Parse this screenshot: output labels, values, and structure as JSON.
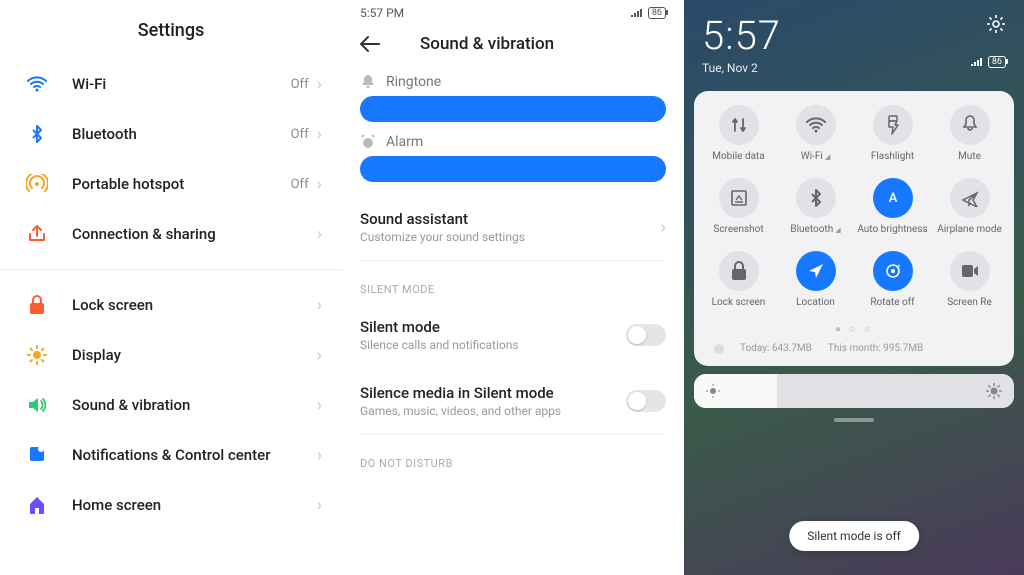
{
  "panel1": {
    "title": "Settings",
    "groups": [
      [
        {
          "icon": "wifi",
          "color": "#1677ff",
          "label": "Wi-Fi",
          "status": "Off"
        },
        {
          "icon": "bluetooth",
          "color": "#1677ff",
          "label": "Bluetooth",
          "status": "Off"
        },
        {
          "icon": "hotspot",
          "color": "#f5a623",
          "label": "Portable hotspot",
          "status": "Off"
        },
        {
          "icon": "share",
          "color": "#ff5b2e",
          "label": "Connection & sharing",
          "status": ""
        }
      ],
      [
        {
          "icon": "lock",
          "color": "#ff5b2e",
          "label": "Lock screen",
          "status": ""
        },
        {
          "icon": "sun",
          "color": "#f5a623",
          "label": "Display",
          "status": ""
        },
        {
          "icon": "volume",
          "color": "#2ecc71",
          "label": "Sound & vibration",
          "status": ""
        },
        {
          "icon": "bell",
          "color": "#1677ff",
          "label": "Notifications & Control center",
          "status": ""
        },
        {
          "icon": "home",
          "color": "#6b4eff",
          "label": "Home screen",
          "status": ""
        }
      ]
    ]
  },
  "panel2": {
    "status_time": "5:57 PM",
    "battery": "86",
    "title": "Sound & vibration",
    "ringtone_label": "Ringtone",
    "alarm_label": "Alarm",
    "assistant_title": "Sound assistant",
    "assistant_sub": "Customize your sound settings",
    "cat_silent": "SILENT MODE",
    "silent_title": "Silent mode",
    "silent_sub": "Silence calls and notifications",
    "media_title": "Silence media in Silent mode",
    "media_sub": "Games, music, videos, and other apps",
    "cat_dnd": "DO NOT DISTURB"
  },
  "panel3": {
    "clock": "5:57",
    "date": "Tue, Nov 2",
    "battery": "86",
    "tiles": [
      {
        "icon": "data",
        "label": "Mobile data",
        "on": false
      },
      {
        "icon": "wifi",
        "label": "Wi-Fi",
        "on": false,
        "caret": true
      },
      {
        "icon": "flash",
        "label": "Flashlight",
        "on": false
      },
      {
        "icon": "mute",
        "label": "Mute",
        "on": false
      },
      {
        "icon": "screenshot",
        "label": "Screenshot",
        "on": false
      },
      {
        "icon": "bluetooth",
        "label": "Bluetooth",
        "on": false,
        "caret": true
      },
      {
        "icon": "autob",
        "label": "Auto brightness",
        "on": true
      },
      {
        "icon": "plane",
        "label": "Airplane mode",
        "on": false
      },
      {
        "icon": "lock",
        "label": "Lock screen",
        "on": false
      },
      {
        "icon": "location",
        "label": "Location",
        "on": true
      },
      {
        "icon": "rotate",
        "label": "Rotate off",
        "on": true
      },
      {
        "icon": "screenrec",
        "label": "Screen Re",
        "on": false
      }
    ],
    "usage_today": "Today: 643.7MB",
    "usage_month": "This month: 995.7MB",
    "toast": "Silent mode is off"
  }
}
